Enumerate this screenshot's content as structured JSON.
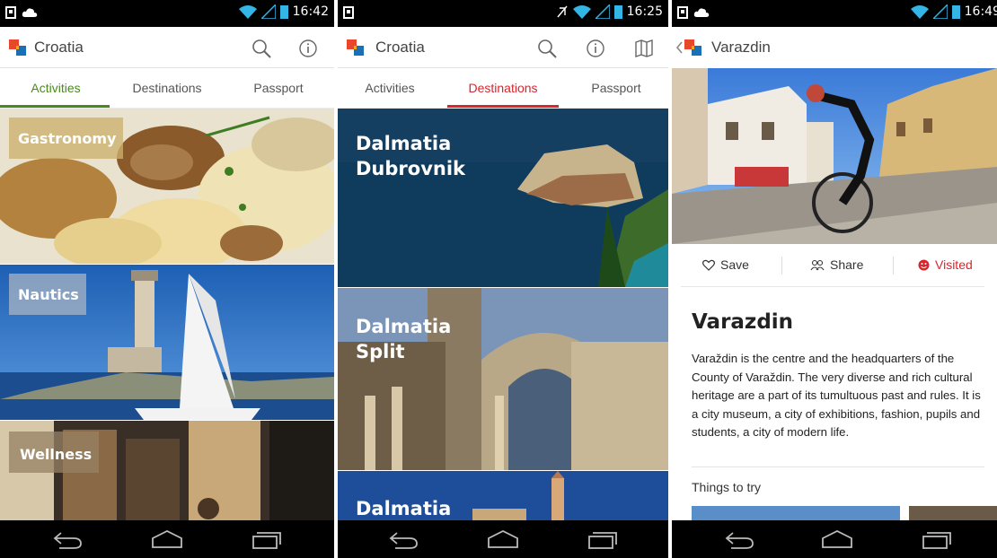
{
  "screens": [
    {
      "status_time": "16:42",
      "app_title": "Croatia",
      "tabs": [
        "Activities",
        "Destinations",
        "Passport"
      ],
      "active_tab": "Activities",
      "tiles": [
        "Gastronomy",
        "Nautics",
        "Wellness"
      ]
    },
    {
      "status_time": "16:25",
      "app_title": "Croatia",
      "tabs": [
        "Activities",
        "Destinations",
        "Passport"
      ],
      "active_tab": "Destinations",
      "tiles": [
        {
          "line1": "Dalmatia",
          "line2": "Dubrovnik"
        },
        {
          "line1": "Dalmatia",
          "line2": "Split"
        },
        {
          "line1": "Dalmatia",
          "line2": ""
        }
      ]
    },
    {
      "status_time": "16:49",
      "app_title": "Varazdin",
      "actions": {
        "save": "Save",
        "share": "Share",
        "visited": "Visited"
      },
      "title": "Varazdin",
      "body": "Varaždin is the centre and the headquarters of the County of Varaždin. The very diverse and rich cultural heritage are a part of its tumultuous past and rules. It is a city museum, a city of exhibitions, fashion, pupils and students, a city of modern life.",
      "things_to_try": "Things to try"
    }
  ],
  "colors": {
    "activities_accent": "#4a8a1c",
    "destinations_accent": "#d8262e",
    "visited_accent": "#d8262e",
    "statusbar_icons": "#33b5e5"
  },
  "icons": [
    "photo-notification-icon",
    "cloud-icon",
    "wifi-icon",
    "signal-icon",
    "battery-icon",
    "search-icon",
    "info-icon",
    "map-icon",
    "back-nav-icon",
    "home-nav-icon",
    "recents-nav-icon",
    "heart-icon",
    "share-icon",
    "visited-icon"
  ]
}
